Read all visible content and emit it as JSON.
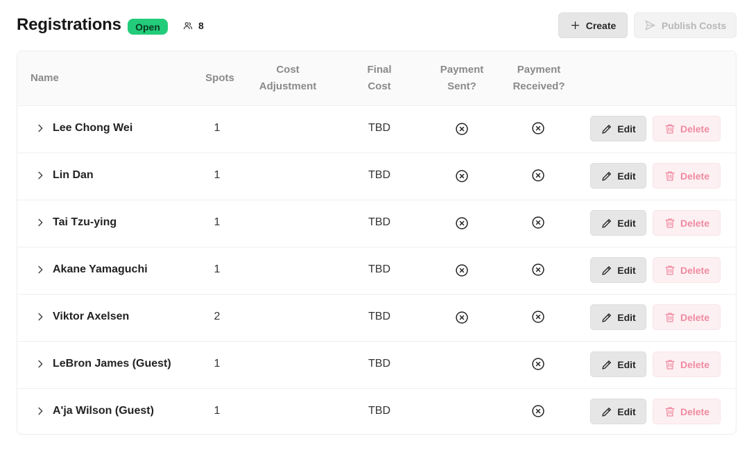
{
  "page": {
    "title": "Registrations",
    "status_badge": "Open",
    "participant_count": "8",
    "icons": {
      "participants": "users-icon"
    }
  },
  "toolbar": {
    "create_label": "Create",
    "publish_label": "Publish Costs"
  },
  "table": {
    "columns": {
      "name": "Name",
      "spots": "Spots",
      "cost_adjustment_line1": "Cost",
      "cost_adjustment_line2": "Adjustment",
      "final_cost_line1": "Final",
      "final_cost_line2": "Cost",
      "payment_sent_line1": "Payment",
      "payment_sent_line2": "Sent?",
      "payment_received_line1": "Payment",
      "payment_received_line2": "Received?"
    },
    "edit_label": "Edit",
    "delete_label": "Delete",
    "rows": [
      {
        "name": "Lee Chong Wei",
        "spots": "1",
        "cost_adjustment": "",
        "final_cost": "TBD",
        "payment_sent": false,
        "payment_received": false
      },
      {
        "name": "Lin Dan",
        "spots": "1",
        "cost_adjustment": "",
        "final_cost": "TBD",
        "payment_sent": false,
        "payment_received": false
      },
      {
        "name": "Tai Tzu-ying",
        "spots": "1",
        "cost_adjustment": "",
        "final_cost": "TBD",
        "payment_sent": false,
        "payment_received": false
      },
      {
        "name": "Akane Yamaguchi",
        "spots": "1",
        "cost_adjustment": "",
        "final_cost": "TBD",
        "payment_sent": false,
        "payment_received": false
      },
      {
        "name": "Viktor Axelsen",
        "spots": "2",
        "cost_adjustment": "",
        "final_cost": "TBD",
        "payment_sent": false,
        "payment_received": false
      },
      {
        "name": "LeBron James (Guest)",
        "spots": "1",
        "cost_adjustment": "",
        "final_cost": "TBD",
        "payment_sent": null,
        "payment_received": false
      },
      {
        "name": "A'ja Wilson (Guest)",
        "spots": "1",
        "cost_adjustment": "",
        "final_cost": "TBD",
        "payment_sent": null,
        "payment_received": false
      }
    ]
  },
  "colors": {
    "badge_bg": "#22cc7a",
    "delete_text": "#f08aa0",
    "delete_bg": "#fdf0f2",
    "muted_header": "#8a8a8a"
  }
}
